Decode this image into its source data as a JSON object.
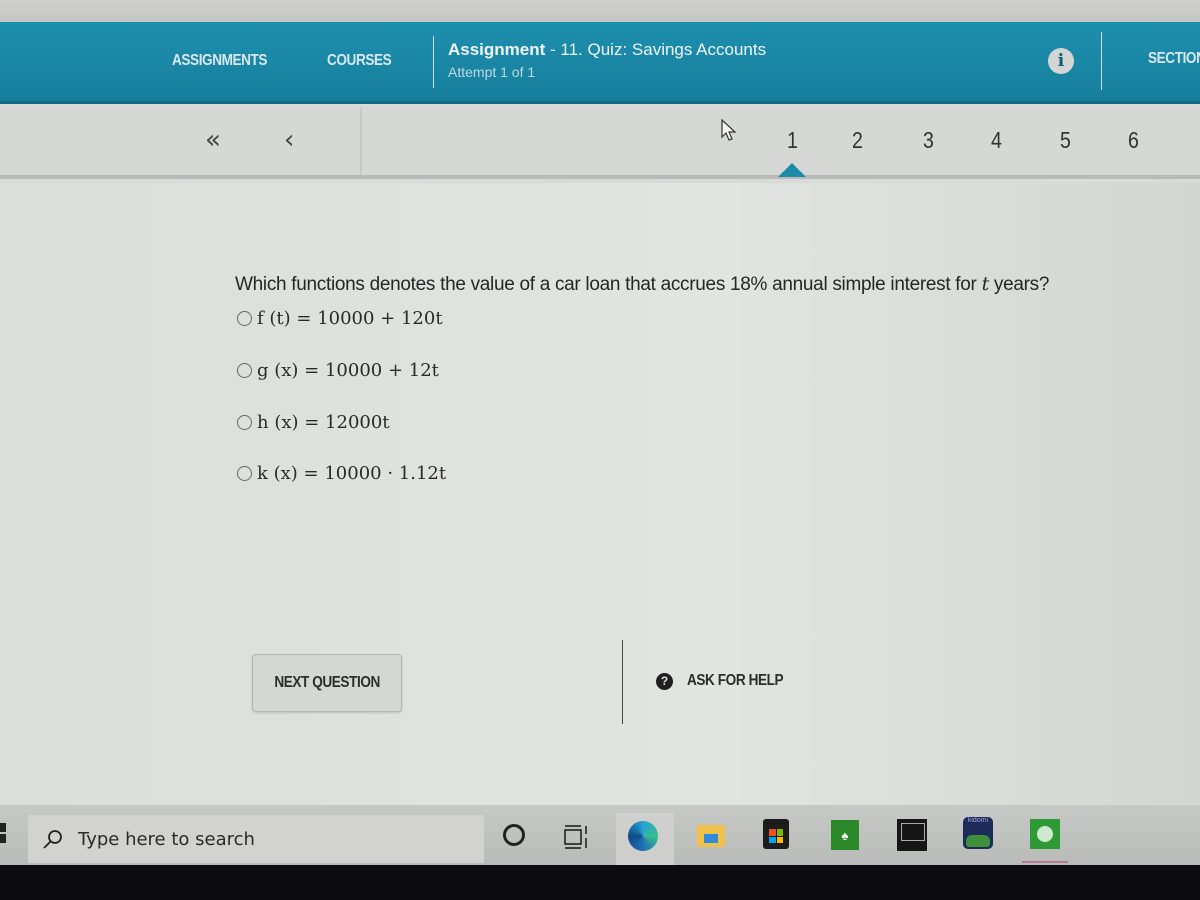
{
  "header": {
    "nav": {
      "assignments": "ASSIGNMENTS",
      "courses": "COURSES",
      "section": "SECTION"
    },
    "title_bold": "Assignment",
    "title_rest": " - 11. Quiz: Savings Accounts",
    "attempt": "Attempt 1 of 1",
    "info_icon": "i",
    "accent_color": "#1e8fae"
  },
  "question_nav": {
    "first_label": "«",
    "prev_label": "‹",
    "numbers": [
      "1",
      "2",
      "3",
      "4",
      "5",
      "6"
    ],
    "current": "1"
  },
  "question": {
    "text_before": "Which functions denotes the value of a car loan that accrues 18% annual simple interest for ",
    "variable": "t",
    "text_after": " years?",
    "options": [
      {
        "label": "f (t) = 10000 + 120t"
      },
      {
        "label": "g (x) = 10000 + 12t"
      },
      {
        "label": "h (x) = 12000t"
      },
      {
        "label": "k (x) = 10000 · 1.12t"
      }
    ]
  },
  "actions": {
    "next_label": "NEXT QUESTION",
    "help_label": "ASK FOR HELP",
    "help_icon": "?"
  },
  "taskbar": {
    "search_placeholder": "Type here to search",
    "apps": [
      "cortana",
      "task-view",
      "edge",
      "file-explorer",
      "microsoft-store",
      "solitaire",
      "laptop-app",
      "kidomi",
      "spotify"
    ],
    "kidomi_label": "kidomi"
  }
}
